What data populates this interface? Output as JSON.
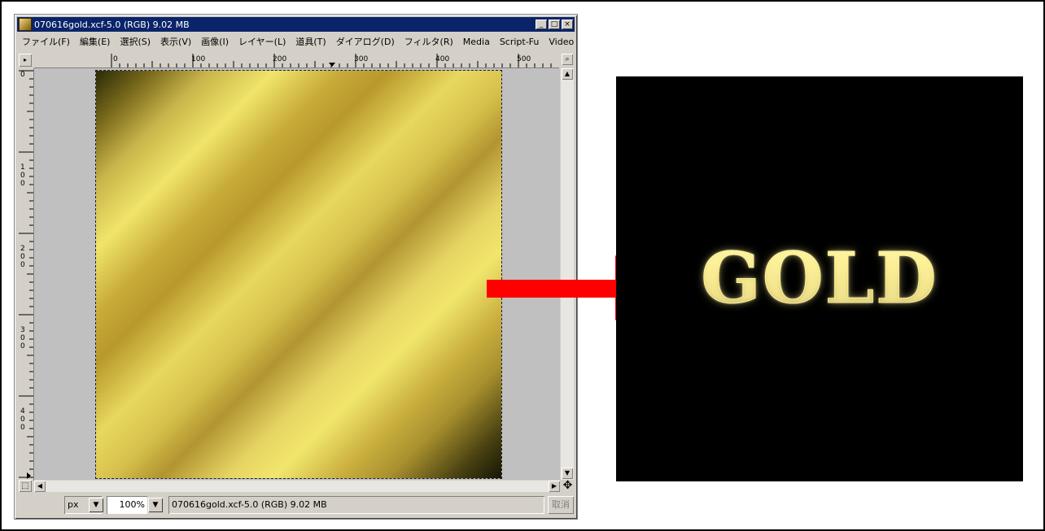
{
  "window": {
    "title": "070616gold.xcf-5.0 (RGB) 9.02 MB",
    "controls": {
      "minimize": "_",
      "maximize": "□",
      "close": "×"
    }
  },
  "menu": [
    "ファイル(F)",
    "編集(E)",
    "選択(S)",
    "表示(V)",
    "画像(I)",
    "レイヤー(L)",
    "道具(T)",
    "ダイアログ(D)",
    "フィルタ(R)",
    "Media",
    "Script-Fu",
    "Video"
  ],
  "rulers": {
    "horizontal": [
      "0",
      "100",
      "200",
      "300",
      "400",
      "500"
    ],
    "vertical": [
      "0",
      "100",
      "200",
      "300",
      "400"
    ]
  },
  "statusbar": {
    "unit": "px",
    "zoom": "100%",
    "info": "070616gold.xcf-5.0 (RGB) 9.02 MB",
    "cancel": "取消"
  },
  "result": {
    "text": "GOLD"
  },
  "colors": {
    "titlebar": "#0a246a",
    "arrow": "#ff0000",
    "result_bg": "#000000",
    "gold": "#d6b93a"
  },
  "icons": {
    "app": "gimp-image-icon",
    "navigate": "four-way-arrow-icon",
    "zoom": "magnifier-icon"
  }
}
